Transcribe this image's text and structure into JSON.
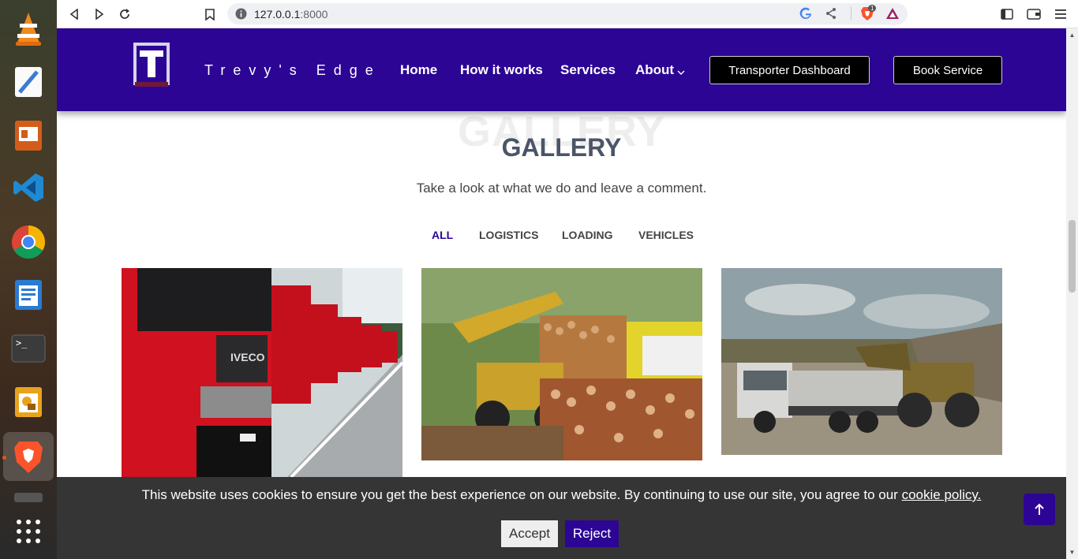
{
  "browser": {
    "url_host": "127.0.0.1",
    "url_port": ":8000",
    "shield_count": "1"
  },
  "header": {
    "brand": "Trevy's Edge",
    "nav": [
      "Home",
      "How it works",
      "Services",
      "About"
    ],
    "dashboard_button": "Transporter Dashboard",
    "book_button": "Book Service"
  },
  "gallery": {
    "background_title": "GALLERY",
    "title": "GALLERY",
    "subtitle": "Take a look at what we do and leave a comment.",
    "filters": [
      "ALL",
      "LOGISTICS",
      "LOADING",
      "VEHICLES"
    ],
    "active_filter": "ALL"
  },
  "cookie": {
    "text": "This website uses cookies to ensure you get the best experience on our website. By continuing to use our site, you agree to our",
    "link": "cookie policy.",
    "accept": "Accept",
    "reject": "Reject"
  },
  "colors": {
    "brand_purple": "#2c0595",
    "cookie_bg": "#353535"
  }
}
